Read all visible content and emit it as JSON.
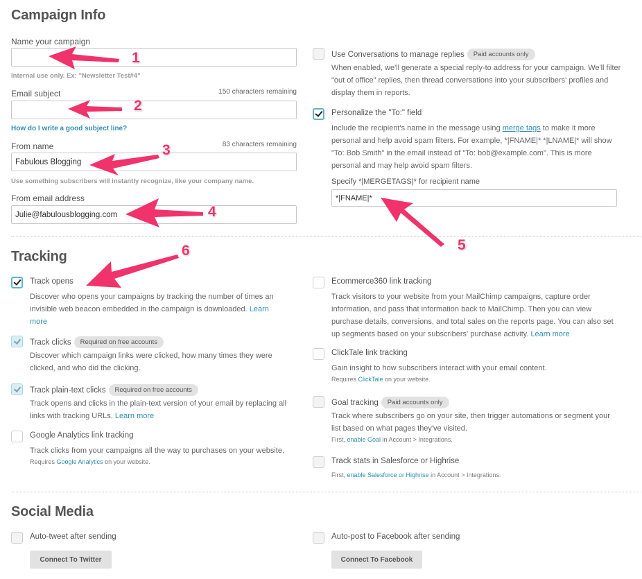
{
  "campaign_info": {
    "title": "Campaign Info",
    "fields": {
      "name": {
        "label": "Name your campaign",
        "value": "",
        "help": "Internal use only. Ex: \"Newsletter Test#4\""
      },
      "subject": {
        "label": "Email subject",
        "counter": "150 characters remaining",
        "value": "",
        "help_link": "How do I write a good subject line?"
      },
      "from_name": {
        "label": "From name",
        "counter": "83 characters remaining",
        "value": "Fabulous Blogging",
        "help": "Use something subscribers will instantly recognize, like your company name."
      },
      "from_email": {
        "label": "From email address",
        "value": "Julie@fabulousblogging.com"
      }
    },
    "conversations": {
      "title": "Use Conversations to manage replies",
      "badge": "Paid accounts only",
      "checked": false,
      "desc": "When enabled, we'll generate a special reply-to address for your campaign. We'll filter \"out of office\" replies, then thread conversations into your subscribers' profiles and display them in reports."
    },
    "personalize": {
      "title": "Personalize the \"To:\" field",
      "checked": true,
      "desc_before": "Include the recipient's name in the message using ",
      "desc_link": "merge tags",
      "desc_after": " to make it more personal and help avoid spam filters. For example, *|FNAME|* *|LNAME|* will show \"To: Bob Smith\" in the email instead of \"To: bob@example.com\". This is more personal and may help avoid spam filters.",
      "merge_label": "Specify *|MERGETAGS|* for recipient name",
      "merge_value": "*|FNAME|*"
    }
  },
  "tracking": {
    "title": "Tracking",
    "track_opens": {
      "title": "Track opens",
      "checked": true,
      "desc": "Discover who opens your campaigns by tracking the number of times an invisible web beacon embedded in the campaign is downloaded. ",
      "link": "Learn more"
    },
    "track_clicks": {
      "title": "Track clicks",
      "badge": "Required on free accounts",
      "checked": true,
      "desc": "Discover which campaign links were clicked, how many times they were clicked, and who did the clicking."
    },
    "track_plaintext": {
      "title": "Track plain-text clicks",
      "badge": "Required on free accounts",
      "checked": true,
      "desc": "Track opens and clicks in the plain-text version of your email by replacing all links with tracking URLs. ",
      "link": "Learn more"
    },
    "google_analytics": {
      "title": "Google Analytics link tracking",
      "checked": false,
      "desc": "Track clicks from your campaigns all the way to purchases on your website.",
      "note_before": "Requires ",
      "note_link": "Google Analytics",
      "note_after": " on your website."
    },
    "ecommerce360": {
      "title": "Ecommerce360 link tracking",
      "checked": false,
      "desc": "Track visitors to your website from your MailChimp campaigns, capture order information, and pass that information back to MailChimp. Then you can view purchase details, conversions, and total sales on the reports page. You can also set up segments based on your subscribers' purchase activity. ",
      "link": "Learn more"
    },
    "clicktale": {
      "title": "ClickTale link tracking",
      "checked": false,
      "desc": "Gain insight to how subscribers interact with your email content.",
      "note_before": "Requires ",
      "note_link": "ClickTale",
      "note_after": " on your website."
    },
    "goal": {
      "title": "Goal tracking",
      "badge": "Paid accounts only",
      "checked": false,
      "desc": "Track where subscribers go on your site, then trigger automations or segment your list based on what pages they've visited.",
      "note_before": "First, ",
      "note_link": "enable Goal",
      "note_after": " in Account > Integrations."
    },
    "salesforce": {
      "title": "Track stats in Salesforce or Highrise",
      "checked": false,
      "note_before": "First, ",
      "note_link": "enable Salesforce or Highrise",
      "note_after": " in Account > Integrations."
    }
  },
  "social_media": {
    "title": "Social Media",
    "twitter": {
      "title": "Auto-tweet after sending",
      "checked": false,
      "button": "Connect To Twitter"
    },
    "facebook": {
      "title": "Auto-post to Facebook after sending",
      "checked": false,
      "button": "Connect To Facebook"
    }
  },
  "annotations": [
    "1",
    "2",
    "3",
    "4",
    "5",
    "6"
  ],
  "colors": {
    "link": "#2f8fae",
    "annotation": "#f0336b",
    "checkbox_checked_border": "#5fb5c9",
    "badge_bg": "#e2e2e2"
  }
}
